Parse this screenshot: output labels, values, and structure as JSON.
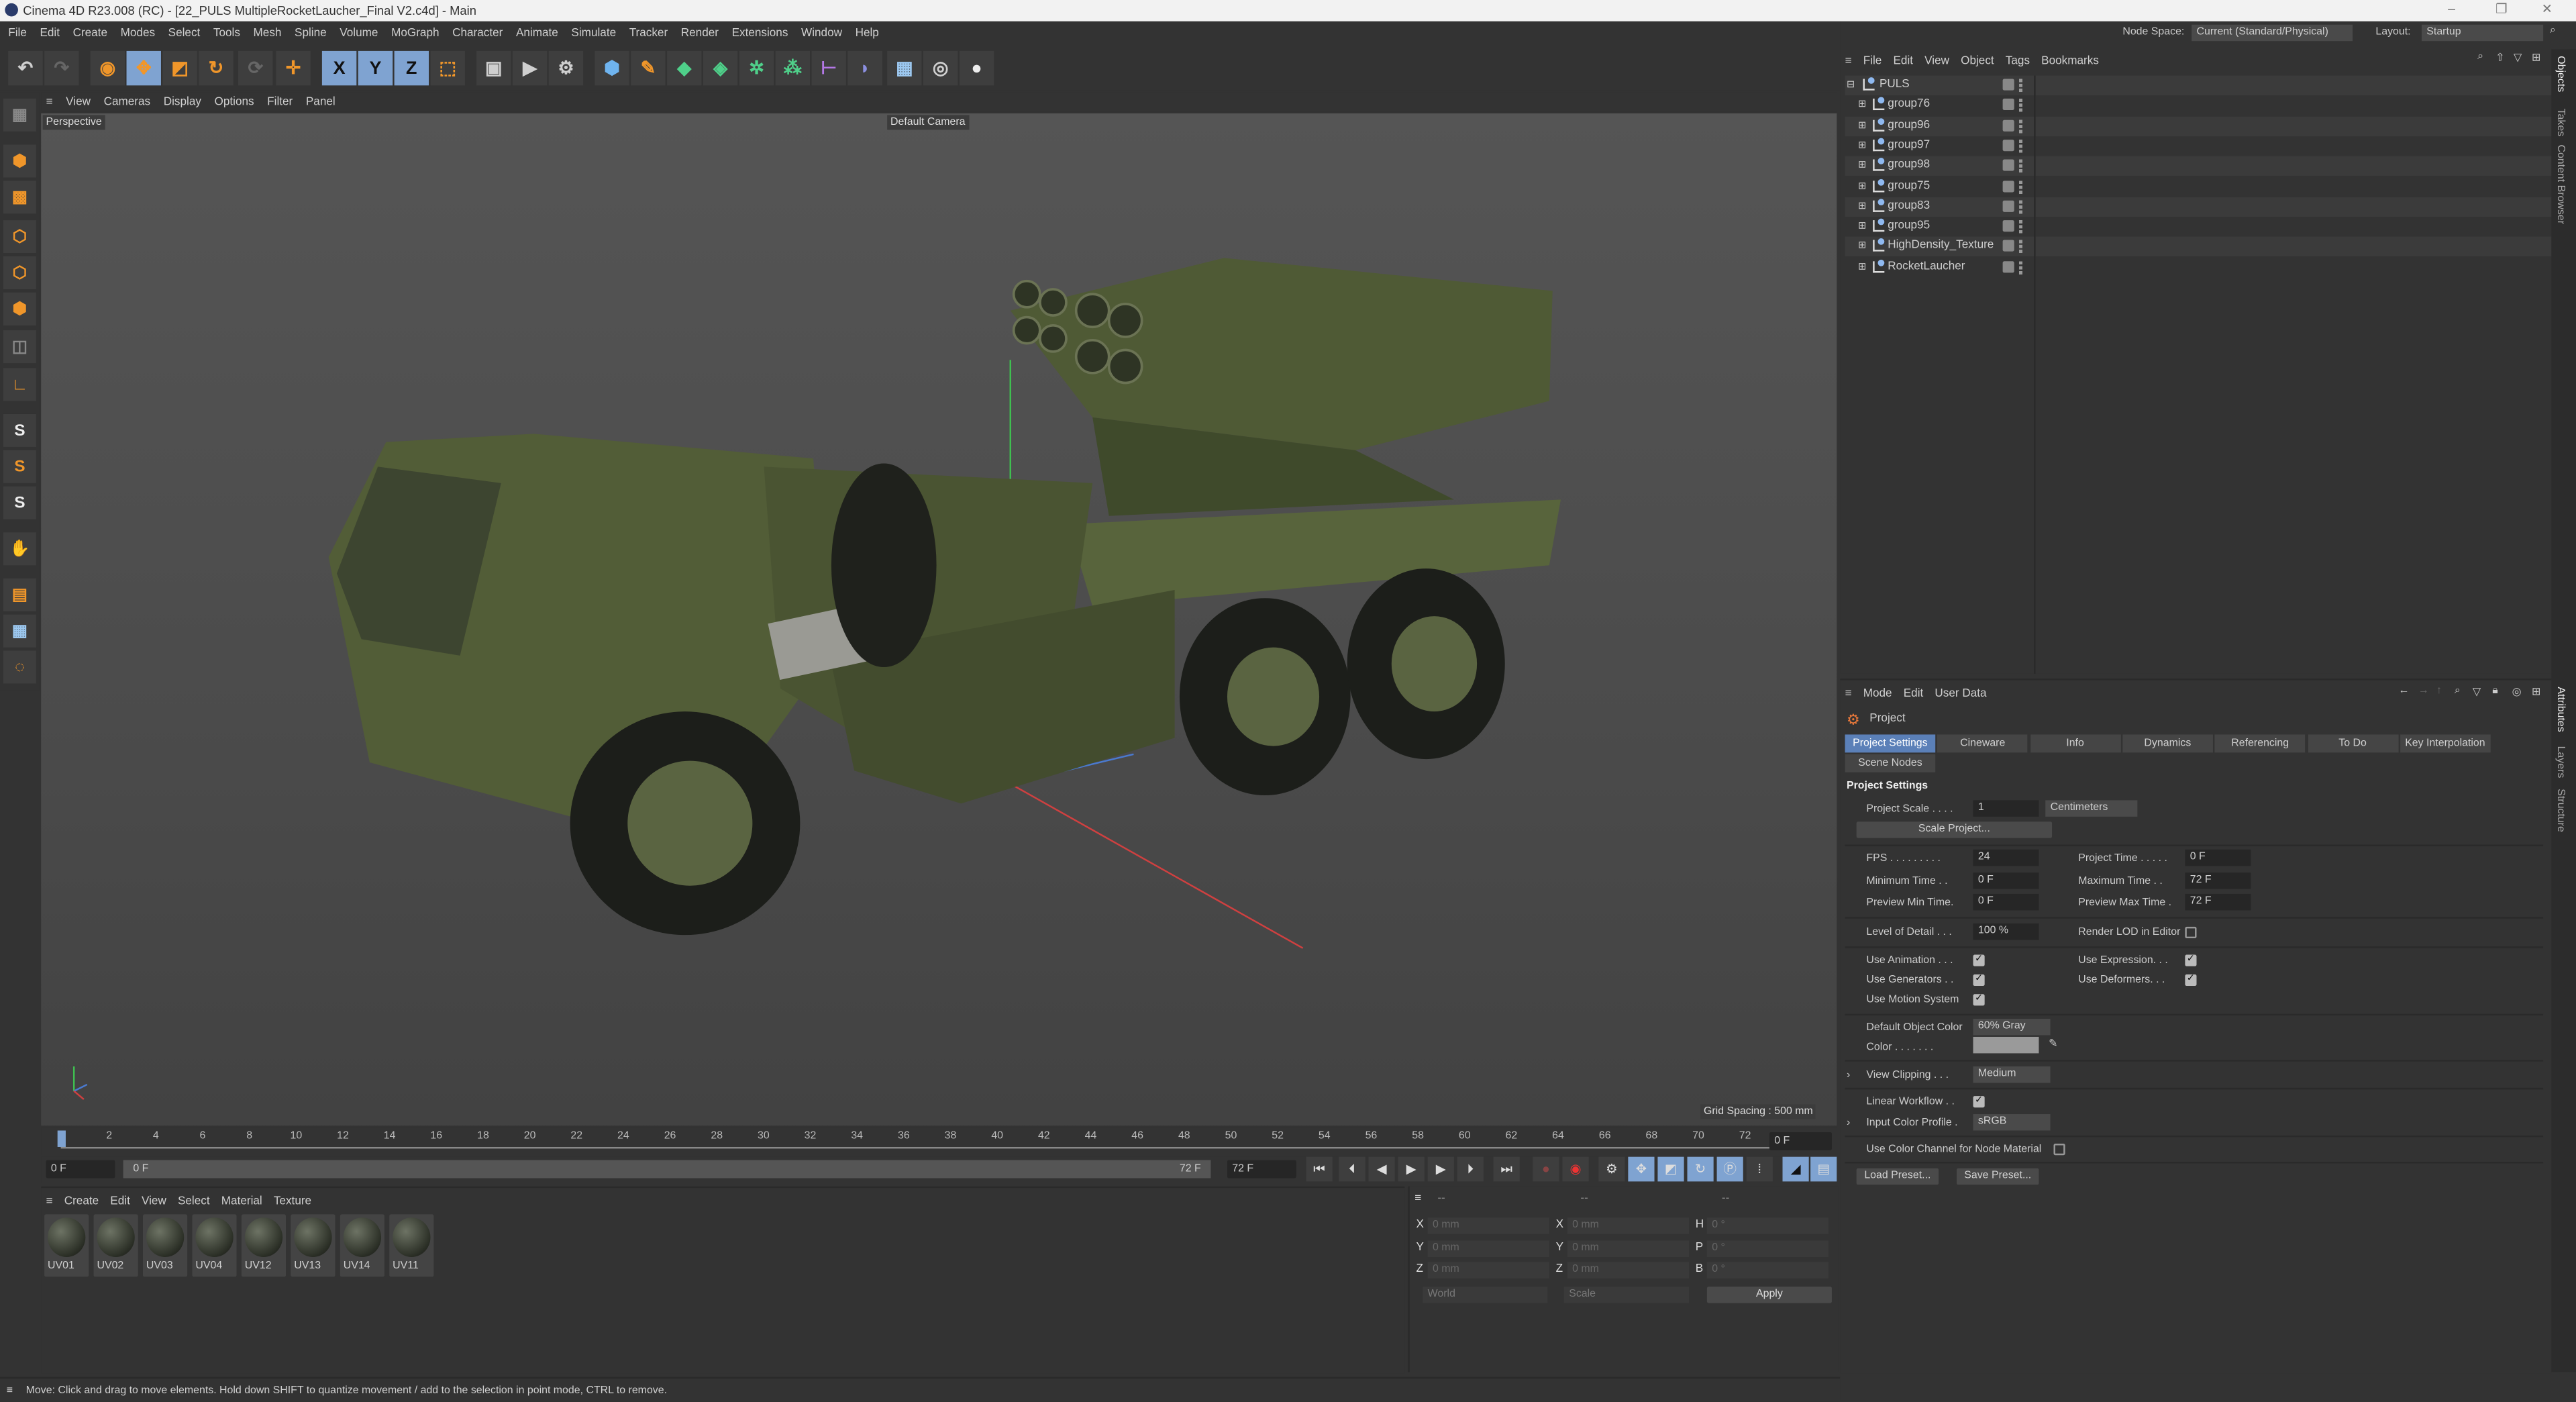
{
  "window": {
    "title": "Cinema 4D R23.008 (RC) - [22_PULS MultipleRocketLaucher_Final V2.c4d] - Main",
    "controls": [
      "–",
      "❐",
      "✕"
    ]
  },
  "menu": [
    "File",
    "Edit",
    "Create",
    "Modes",
    "Select",
    "Tools",
    "Mesh",
    "Spline",
    "Volume",
    "MoGraph",
    "Character",
    "Animate",
    "Simulate",
    "Tracker",
    "Render",
    "Extensions",
    "Window",
    "Help"
  ],
  "topright": {
    "node_space_label": "Node Space:",
    "node_space_value": "Current (Standard/Physical)",
    "layout_label": "Layout:",
    "layout_value": "Startup"
  },
  "toolbar": {
    "axis_x": "X",
    "axis_y": "Y",
    "axis_z": "Z"
  },
  "viewport": {
    "menu": [
      "View",
      "Cameras",
      "Display",
      "Options",
      "Filter",
      "Panel"
    ],
    "view_name": "Perspective",
    "camera": "Default Camera",
    "grid_spacing": "Grid Spacing : 500 mm"
  },
  "timeline": {
    "ticks": [
      "0",
      "2",
      "4",
      "6",
      "8",
      "10",
      "12",
      "14",
      "16",
      "18",
      "20",
      "22",
      "24",
      "26",
      "28",
      "30",
      "32",
      "34",
      "36",
      "38",
      "40",
      "42",
      "44",
      "46",
      "48",
      "50",
      "52",
      "54",
      "56",
      "58",
      "60",
      "62",
      "64",
      "66",
      "68",
      "70",
      "72"
    ],
    "current_frame": "0 F",
    "start_field": "0 F",
    "range_start": "0 F",
    "range_end": "72 F",
    "end_field": "72 F"
  },
  "materials": {
    "menu": [
      "Create",
      "Edit",
      "View",
      "Select",
      "Material",
      "Texture"
    ],
    "items": [
      "UV01",
      "UV02",
      "UV03",
      "UV04",
      "UV12",
      "UV13",
      "UV14",
      "UV11"
    ]
  },
  "coordinates": {
    "headers": [
      "--",
      "--",
      "--"
    ],
    "rows": [
      {
        "a": "X",
        "av": "0 mm",
        "b": "X",
        "bv": "0 mm",
        "c": "H",
        "cv": "0 °"
      },
      {
        "a": "Y",
        "av": "0 mm",
        "b": "Y",
        "bv": "0 mm",
        "c": "P",
        "cv": "0 °"
      },
      {
        "a": "Z",
        "av": "0 mm",
        "b": "Z",
        "bv": "0 mm",
        "c": "B",
        "cv": "0 °"
      }
    ],
    "space": "World",
    "mode": "Scale",
    "apply": "Apply"
  },
  "status": "Move: Click and drag to move elements. Hold down SHIFT to quantize movement / add to the selection in point mode, CTRL to remove.",
  "objects": {
    "menu": [
      "File",
      "Edit",
      "View",
      "Object",
      "Tags",
      "Bookmarks"
    ],
    "root": "PULS",
    "children": [
      "group76",
      "group96",
      "group97",
      "group98",
      "group75",
      "group83",
      "group95",
      "HighDensity_Texture",
      "RocketLaucher"
    ]
  },
  "attributes": {
    "menu": [
      "Mode",
      "Edit",
      "User Data"
    ],
    "object": "Project",
    "tabs": [
      "Project Settings",
      "Cineware",
      "Info",
      "Dynamics",
      "Referencing",
      "To Do",
      "Key Interpolation",
      "Scene Nodes"
    ],
    "section": "Project Settings",
    "project_scale_label": "Project Scale . . . .",
    "project_scale": "1",
    "units": "Centimeters",
    "scale_project": "Scale Project...",
    "fps_label": "FPS . . . . . . . . .",
    "fps": "24",
    "project_time_label": "Project Time . . . . .",
    "project_time": "0 F",
    "min_time_label": "Minimum Time . .",
    "min_time": "0 F",
    "max_time_label": "Maximum Time . .",
    "max_time": "72 F",
    "prev_min_label": "Preview Min Time.",
    "prev_min": "0 F",
    "prev_max_label": "Preview Max Time .",
    "prev_max": "72 F",
    "lod_label": "Level of Detail . . .",
    "lod": "100 %",
    "render_lod_label": "Render LOD in Editor",
    "use_animation": "Use Animation . . .",
    "use_expression": "Use Expression. . .",
    "use_generators": "Use Generators . .",
    "use_deformers": "Use Deformers. . .",
    "use_motion": "Use Motion System",
    "default_color_label": "Default Object Color",
    "default_color": "60% Gray",
    "color_label": "Color . . . . . . .",
    "color_swatch": "#9a9a9a",
    "view_clipping_label": "View Clipping . . .",
    "view_clipping": "Medium",
    "linear_workflow_label": "Linear Workflow . .",
    "input_profile_label": "Input Color Profile .",
    "input_profile": "sRGB",
    "node_material_label": "Use Color Channel for Node Material",
    "load_preset": "Load Preset...",
    "save_preset": "Save Preset..."
  },
  "side_tabs": {
    "top": [
      "Objects",
      "Takes",
      "Content Browser"
    ],
    "bottom": [
      "Attributes",
      "Layers",
      "Structure"
    ]
  },
  "colors": {
    "accent": "#7fa3d1",
    "tab_active": "#5b80b8",
    "tool_orange": "#f0962a",
    "truck": "#4f5a35"
  }
}
